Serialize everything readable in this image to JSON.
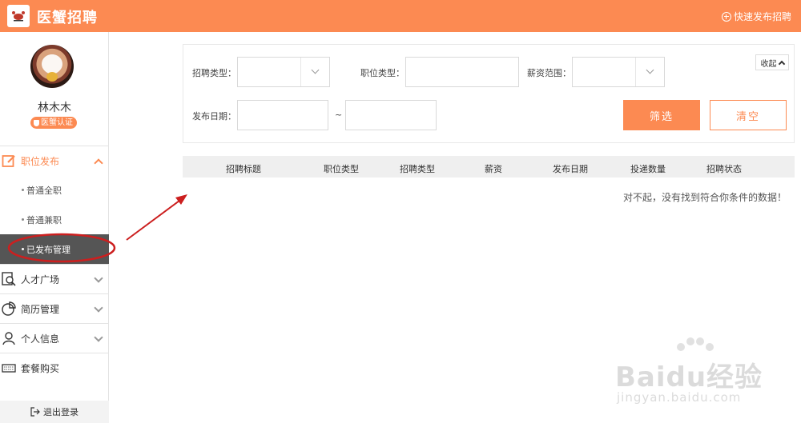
{
  "header": {
    "brand": "医蟹招聘",
    "quick_post": "快速发布招聘"
  },
  "profile": {
    "username": "林木木",
    "badge": "医蟹认证"
  },
  "sidebar": {
    "job_post": "职位发布",
    "sub_items": [
      "普通全职",
      "普通兼职",
      "已发布管理"
    ],
    "talent": "人才广场",
    "resume": "简历管理",
    "personal": "个人信息",
    "package": "套餐购买",
    "logout": "退出登录"
  },
  "filter": {
    "recruit_type_label": "招聘类型：",
    "job_type_label": "职位类型：",
    "salary_label": "薪资范围：",
    "date_label": "发布日期：",
    "date_sep": "~",
    "collapse": "收起",
    "filter_btn": "筛选",
    "clear_btn": "清空"
  },
  "table": {
    "columns": [
      "招聘标题",
      "职位类型",
      "招聘类型",
      "薪资",
      "发布日期",
      "投递数量",
      "招聘状态"
    ],
    "empty_message": "对不起，没有找到符合你条件的数据！"
  },
  "watermark": {
    "text": "Baidu经验",
    "url": "jingyan.baidu.com"
  },
  "colors": {
    "accent": "#fc8a52",
    "annotation": "#cc1f1f",
    "active_bg": "#555555"
  }
}
